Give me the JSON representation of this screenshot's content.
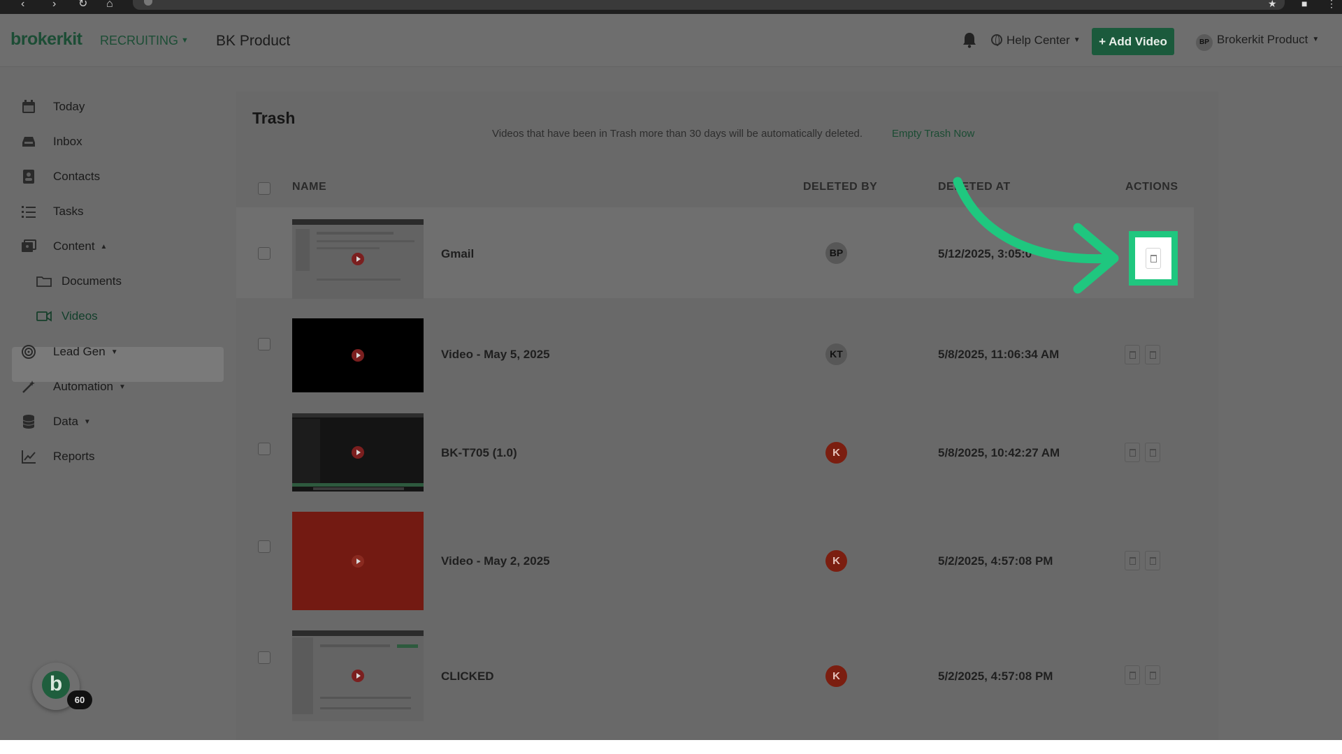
{
  "app": {
    "logo": "brokerkit",
    "module": "RECRUITING",
    "workspace": "BK Product"
  },
  "header": {
    "help_label": "Help Center",
    "add_video_label": "+ Add Video",
    "user_initials": "BP",
    "user_name": "Brokerkit Product"
  },
  "sidebar": {
    "items": [
      {
        "label": "Today",
        "icon": "calendar-icon"
      },
      {
        "label": "Inbox",
        "icon": "inbox-icon"
      },
      {
        "label": "Contacts",
        "icon": "contacts-icon"
      },
      {
        "label": "Tasks",
        "icon": "tasks-icon"
      },
      {
        "label": "Content",
        "icon": "content-icon"
      },
      {
        "label": "Documents",
        "icon": "folder-icon"
      },
      {
        "label": "Videos",
        "icon": "video-icon"
      },
      {
        "label": "Lead Gen",
        "icon": "lead-gen-icon"
      },
      {
        "label": "Automation",
        "icon": "wand-icon"
      },
      {
        "label": "Data",
        "icon": "database-icon"
      },
      {
        "label": "Reports",
        "icon": "chart-icon"
      }
    ],
    "active": "Videos",
    "badge_count": "60",
    "badge_letter": "b"
  },
  "page": {
    "title": "Trash",
    "notice": "Videos that have been in Trash more than 30 days will be automatically deleted.",
    "empty_trash_link": "Empty Trash Now"
  },
  "table": {
    "headers": {
      "name": "NAME",
      "deleted_by": "DELETED BY",
      "deleted_at": "DELETED AT",
      "actions": "ACTIONS"
    },
    "rows": [
      {
        "name": "Gmail",
        "deleted_by": "BP",
        "deleted_at": "5/12/2025, 3:05:0",
        "thumb_style": "screen-light"
      },
      {
        "name": "Video - May 5, 2025",
        "deleted_by": "KT",
        "deleted_at": "5/8/2025, 11:06:34 AM",
        "thumb_style": "black"
      },
      {
        "name": "BK-T705 (1.0)",
        "deleted_by": "K",
        "deleted_at": "5/8/2025, 10:42:27 AM",
        "thumb_style": "screen-dark"
      },
      {
        "name": "Video - May 2, 2025",
        "deleted_by": "K",
        "deleted_at": "5/2/2025, 4:57:08 PM",
        "thumb_style": "red"
      },
      {
        "name": "CLICKED",
        "deleted_by": "K",
        "deleted_at": "5/2/2025, 4:57:08 PM",
        "thumb_style": "screen-light"
      }
    ]
  },
  "colors": {
    "brand": "#1c4d35",
    "highlight": "#1fc77f",
    "avatar_k": "#7b1e10"
  }
}
